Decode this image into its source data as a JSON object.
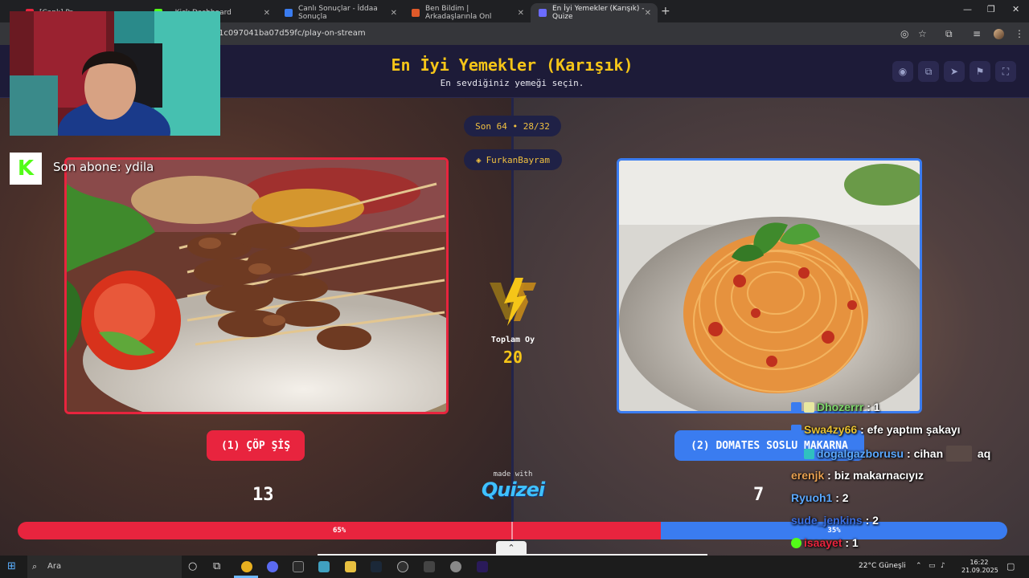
{
  "browser": {
    "tabs": [
      {
        "label": "[Canlı] Pr",
        "color": "#e8243e"
      },
      {
        "label": "...Kick Dashboard",
        "color": "#53fc18"
      },
      {
        "label": "Canlı Sonuçlar - İddaa Sonuçla",
        "color": "#3a7cf0"
      },
      {
        "label": "Ben Bildim | Arkadaşlarınla Onl",
        "color": "#e05a2a"
      },
      {
        "label": "En İyi Yemekler (Karışık) - Quize",
        "color": "#6b6bff"
      }
    ],
    "url": "1c097041ba07d59fc/play-on-stream"
  },
  "quiz": {
    "title": "En İyi Yemekler (Karışık)",
    "subtitle": "En sevdiğiniz yemeği seçin.",
    "round": "Son 64 • 28/32",
    "creator": "FurkanBayram",
    "left_choice": "(1) ÇÖP ŞİŞ",
    "right_choice": "(2) DOMATES SOSLU MAKARNA",
    "left_votes": "13",
    "right_votes": "7",
    "total_label": "Toplam Oy",
    "total_votes": "20",
    "left_pct_label": "65%",
    "right_pct_label": "35%",
    "left_share": 0.65,
    "made_with": "made with",
    "brand": "Quizei",
    "colors": {
      "left": "#e8243e",
      "right": "#3a7cf0",
      "accent": "#f5c518"
    }
  },
  "overlay": {
    "kick_logo": "K",
    "last_sub": "Son abone: ydila",
    "chat": [
      {
        "user": "Dhozerrr",
        "msg": ": 1",
        "color": "#7cd66a"
      },
      {
        "user": "Swa4zy66",
        "msg": ": efe yaptım şakayı",
        "color": "#e8c030"
      },
      {
        "user": "dogalgazborusu",
        "msg": ": cihan",
        "extra": "aq",
        "color": "#5aa8ff"
      },
      {
        "user": "erenjk",
        "msg": ": biz makarnacıyız",
        "color": "#e8a050"
      },
      {
        "user": "Ryuoh1",
        "msg": ": 2",
        "color": "#5aa8ff"
      },
      {
        "user": "sude_jenkins",
        "msg": ": 2",
        "color": "#3a6ee0"
      },
      {
        "user": "isaayet",
        "msg": ": 1",
        "color": "#e8243e"
      }
    ]
  },
  "taskbar": {
    "search_placeholder": "Ara",
    "weather": "22°C  Güneşli",
    "time": "16:22",
    "date": "21.09.2025"
  }
}
